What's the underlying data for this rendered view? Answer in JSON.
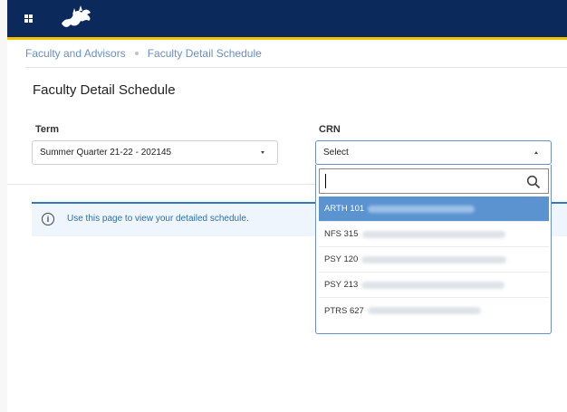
{
  "breadcrumb": {
    "items": [
      "Faculty and Advisors",
      "Faculty Detail Schedule"
    ]
  },
  "page": {
    "title": "Faculty Detail Schedule"
  },
  "term": {
    "label": "Term",
    "value": "Summer Quarter 21-22 - 202145"
  },
  "crn": {
    "label": "CRN",
    "value": "Select",
    "options": [
      {
        "code": "ARTH 101",
        "selected": true
      },
      {
        "code": "NFS 315",
        "selected": false
      },
      {
        "code": "PSY 120",
        "selected": false
      },
      {
        "code": "PSY 213",
        "selected": false
      },
      {
        "code": "PTRS 627",
        "selected": false
      }
    ]
  },
  "info": {
    "text": "Use this page to view your detailed schedule.",
    "icon": "info-icon"
  },
  "colors": {
    "header": "#0b2a5b",
    "accent": "#f2c400",
    "selected": "#5b93d1",
    "link": "#6a8fc4"
  }
}
